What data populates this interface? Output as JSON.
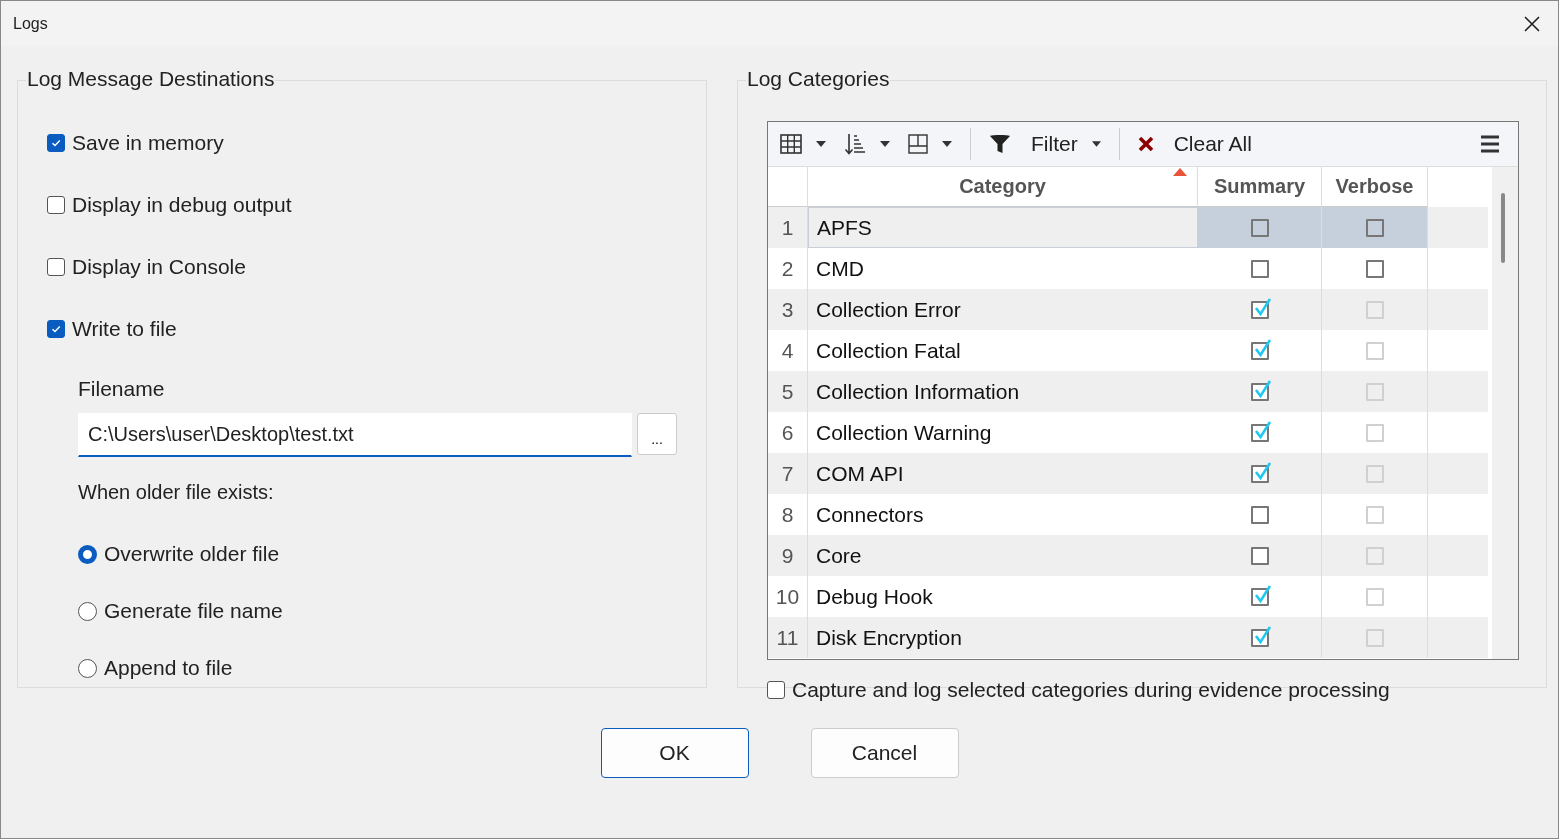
{
  "window": {
    "title": "Logs"
  },
  "destinations": {
    "title": "Log Message Destinations",
    "options": [
      {
        "label": "Save in memory",
        "checked": true
      },
      {
        "label": "Display in debug output",
        "checked": false
      },
      {
        "label": "Display in Console",
        "checked": false
      },
      {
        "label": "Write to file",
        "checked": true
      }
    ],
    "filename": {
      "label": "Filename",
      "value": "C:\\Users\\user\\Desktop\\test.txt",
      "browse": "..."
    },
    "exists_label": "When older file exists:",
    "radios": [
      {
        "label": "Overwrite older file",
        "selected": true
      },
      {
        "label": "Generate file name",
        "selected": false
      },
      {
        "label": "Append to file",
        "selected": false
      }
    ]
  },
  "categories": {
    "title": "Log Categories",
    "toolbar": {
      "filter": "Filter",
      "clear": "Clear All"
    },
    "columns": [
      {
        "label": "Category",
        "sorted": true
      },
      {
        "label": "Summary",
        "sorted": false
      },
      {
        "label": "Verbose",
        "sorted": false
      }
    ],
    "rows": [
      {
        "number": "1",
        "category": "APFS",
        "selected": true,
        "summary": false,
        "verbose": false,
        "verbose_disabled": false
      },
      {
        "number": "2",
        "category": "CMD",
        "selected": false,
        "summary": false,
        "verbose": false,
        "verbose_disabled": false
      },
      {
        "number": "3",
        "category": "Collection Error",
        "selected": false,
        "summary": true,
        "verbose": false,
        "verbose_disabled": true
      },
      {
        "number": "4",
        "category": "Collection Fatal",
        "selected": false,
        "summary": true,
        "verbose": false,
        "verbose_disabled": true
      },
      {
        "number": "5",
        "category": "Collection Information",
        "selected": false,
        "summary": true,
        "verbose": false,
        "verbose_disabled": true
      },
      {
        "number": "6",
        "category": "Collection Warning",
        "selected": false,
        "summary": true,
        "verbose": false,
        "verbose_disabled": true
      },
      {
        "number": "7",
        "category": "COM API",
        "selected": false,
        "summary": true,
        "verbose": false,
        "verbose_disabled": true
      },
      {
        "number": "8",
        "category": "Connectors",
        "selected": false,
        "summary": false,
        "verbose": false,
        "verbose_disabled": true
      },
      {
        "number": "9",
        "category": "Core",
        "selected": false,
        "summary": false,
        "verbose": false,
        "verbose_disabled": true
      },
      {
        "number": "10",
        "category": "Debug Hook",
        "selected": false,
        "summary": true,
        "verbose": false,
        "verbose_disabled": true
      },
      {
        "number": "11",
        "category": "Disk Encryption",
        "selected": false,
        "summary": true,
        "verbose": false,
        "verbose_disabled": true
      }
    ],
    "capture": {
      "label": "Capture and log selected categories during evidence processing",
      "checked": false
    }
  },
  "buttons": [
    {
      "label": "OK",
      "default": true
    },
    {
      "label": "Cancel",
      "default": false
    }
  ]
}
